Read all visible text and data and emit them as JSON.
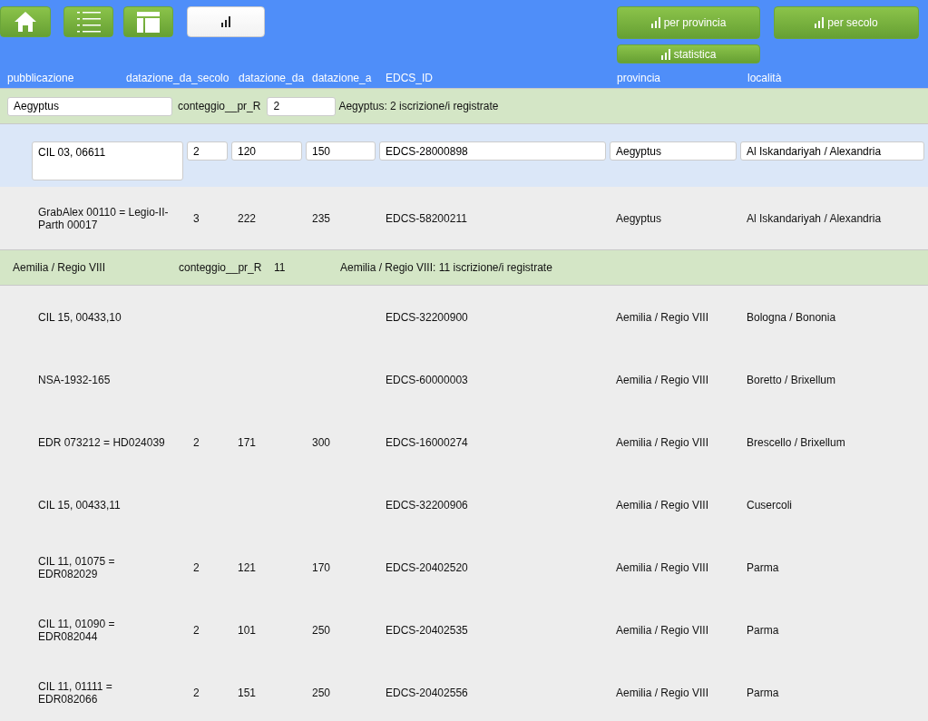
{
  "toolbar": {
    "buttons": [
      {
        "selected": false
      },
      {
        "selected": false
      },
      {
        "selected": false
      },
      {
        "selected": true
      }
    ],
    "stat_buttons": [
      {
        "label": "per provincia"
      },
      {
        "label": "per secolo"
      },
      {
        "label": "statistica"
      }
    ]
  },
  "columns": [
    "pubblicazione",
    "datazione_da_secolo",
    "datazione_da",
    "datazione_a",
    "EDCS_ID",
    "provincia",
    "località"
  ],
  "groups": [
    {
      "name": "Aegyptus",
      "count_label": "conteggio__pr_R",
      "count": "2",
      "summary": "Aegyptus: 2 iscrizione/i registrate",
      "editing": true,
      "rows": [
        {
          "editing": true,
          "cells": [
            "CIL 03, 06611",
            "2",
            "120",
            "150",
            "EDCS-28000898",
            "Aegyptus",
            "Al Iskandariyah / Alexandria"
          ]
        },
        {
          "editing": false,
          "cells": [
            "GrabAlex 00110 = Legio-II-Parth 00017",
            "3",
            "222",
            "235",
            "EDCS-58200211",
            "Aegyptus",
            "Al Iskandariyah / Alexandria"
          ]
        }
      ]
    },
    {
      "name": "Aemilia / Regio VIII",
      "count_label": "conteggio__pr_R",
      "count": "11",
      "summary": "Aemilia / Regio VIII: 11 iscrizione/i registrate",
      "editing": false,
      "rows": [
        {
          "editing": false,
          "cells": [
            "CIL 15, 00433,10",
            "",
            "",
            "",
            "EDCS-32200900",
            "Aemilia / Regio VIII",
            "Bologna / Bononia"
          ]
        },
        {
          "editing": false,
          "cells": [
            "NSA-1932-165",
            "",
            "",
            "",
            "EDCS-60000003",
            "Aemilia / Regio VIII",
            "Boretto / Brixellum"
          ]
        },
        {
          "editing": false,
          "cells": [
            "EDR 073212 = HD024039",
            "2",
            "171",
            "300",
            "EDCS-16000274",
            "Aemilia / Regio VIII",
            "Brescello / Brixellum"
          ]
        },
        {
          "editing": false,
          "cells": [
            "CIL 15, 00433,11",
            "",
            "",
            "",
            "EDCS-32200906",
            "Aemilia / Regio VIII",
            "Cusercoli"
          ]
        },
        {
          "editing": false,
          "cells": [
            "CIL 11, 01075 = EDR082029",
            "2",
            "121",
            "170",
            "EDCS-20402520",
            "Aemilia / Regio VIII",
            "Parma"
          ]
        },
        {
          "editing": false,
          "cells": [
            "CIL 11, 01090 = EDR082044",
            "2",
            "101",
            "250",
            "EDCS-20402535",
            "Aemilia / Regio VIII",
            "Parma"
          ]
        },
        {
          "editing": false,
          "cells": [
            "CIL 11, 01111 = EDR082066",
            "2",
            "151",
            "250",
            "EDCS-20402556",
            "Aemilia / Regio VIII",
            "Parma"
          ]
        }
      ]
    }
  ]
}
